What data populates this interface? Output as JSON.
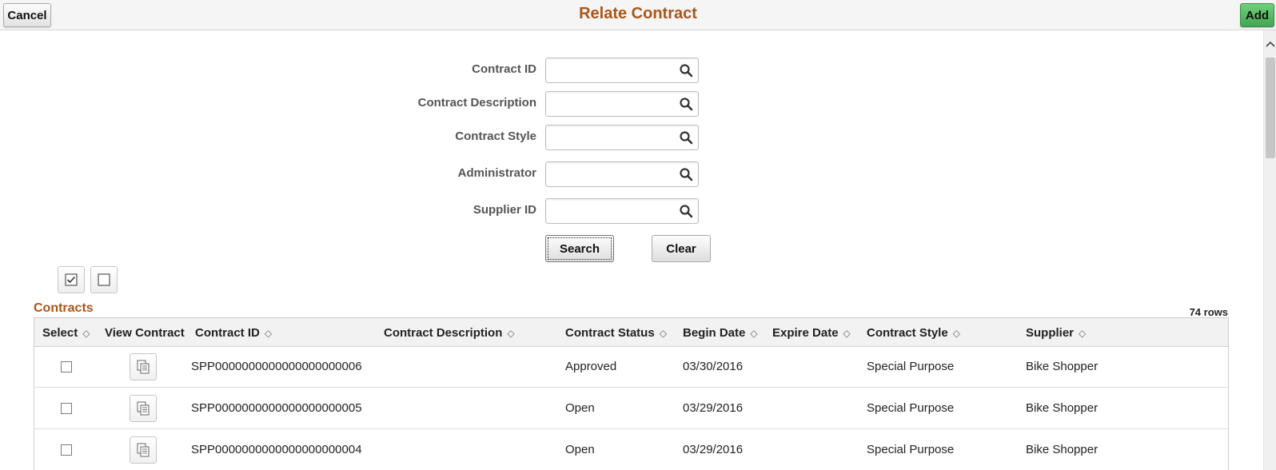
{
  "header": {
    "title": "Relate Contract",
    "cancel_label": "Cancel",
    "add_label": "Add"
  },
  "search_form": {
    "fields": [
      {
        "label": "Contract ID",
        "value": ""
      },
      {
        "label": "Contract Description",
        "value": ""
      },
      {
        "label": "Contract Style",
        "value": ""
      },
      {
        "label": "Administrator",
        "value": ""
      },
      {
        "label": "Supplier ID",
        "value": ""
      }
    ],
    "search_label": "Search",
    "clear_label": "Clear"
  },
  "grid": {
    "title": "Contracts",
    "row_count": "74 rows",
    "columns": [
      {
        "label": "Select",
        "sortable": true
      },
      {
        "label": "View Contract",
        "sortable": false
      },
      {
        "label": "Contract ID",
        "sortable": true
      },
      {
        "label": "Contract Description",
        "sortable": true
      },
      {
        "label": "Contract Status",
        "sortable": true
      },
      {
        "label": "Begin Date",
        "sortable": true
      },
      {
        "label": "Expire Date",
        "sortable": true
      },
      {
        "label": "Contract Style",
        "sortable": true
      },
      {
        "label": "Supplier",
        "sortable": true
      }
    ],
    "rows": [
      {
        "contract_id": "SPP0000000000000000000006",
        "description": "",
        "status": "Approved",
        "begin_date": "03/30/2016",
        "expire_date": "",
        "style": "Special Purpose",
        "supplier": "Bike Shopper",
        "selected": false
      },
      {
        "contract_id": "SPP0000000000000000000005",
        "description": "",
        "status": "Open",
        "begin_date": "03/29/2016",
        "expire_date": "",
        "style": "Special Purpose",
        "supplier": "Bike Shopper",
        "selected": false
      },
      {
        "contract_id": "SPP0000000000000000000004",
        "description": "",
        "status": "Open",
        "begin_date": "03/29/2016",
        "expire_date": "",
        "style": "Special Purpose",
        "supplier": "Bike Shopper",
        "selected": false
      }
    ]
  },
  "icons": {
    "lookup": "search-icon",
    "select_all": "check-all-icon",
    "deselect_all": "uncheck-all-icon",
    "view_contract": "document-icon",
    "sort": "sort-icon"
  },
  "colors": {
    "title": "#a9561a",
    "add_button": "#4fb65d"
  }
}
